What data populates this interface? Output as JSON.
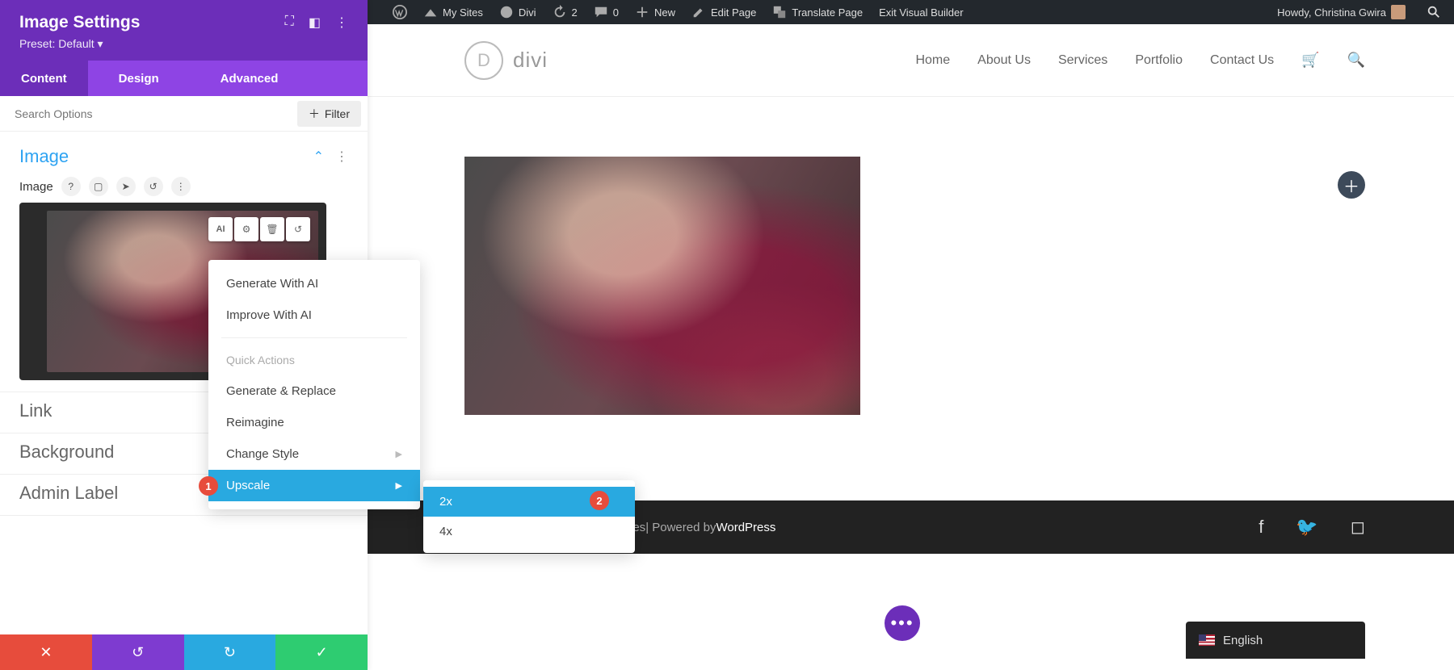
{
  "adminbar": {
    "mysites": "My Sites",
    "divi": "Divi",
    "updates": "2",
    "comments": "0",
    "new": "New",
    "edit": "Edit Page",
    "translate": "Translate Page",
    "exit": "Exit Visual Builder",
    "howdy": "Howdy, Christina Gwira"
  },
  "panel": {
    "title": "Image Settings",
    "preset": "Preset: Default ▾",
    "tabs": {
      "content": "Content",
      "design": "Design",
      "advanced": "Advanced"
    },
    "search_placeholder": "Search Options",
    "filter": "Filter",
    "sections": {
      "image": "Image",
      "image_field": "Image",
      "link": "Link",
      "background": "Background",
      "admin_label": "Admin Label"
    },
    "img_toolbar": {
      "ai": "AI"
    }
  },
  "ai_menu": {
    "generate": "Generate With AI",
    "improve": "Improve With AI",
    "quick": "Quick Actions",
    "replace": "Generate & Replace",
    "reimagine": "Reimagine",
    "change_style": "Change Style",
    "upscale": "Upscale",
    "sub": {
      "x2": "2x",
      "x4": "4x"
    }
  },
  "badges": {
    "one": "1",
    "two": "2"
  },
  "site": {
    "brand": "divi",
    "nav": {
      "home": "Home",
      "about": "About Us",
      "services": "Services",
      "portfolio": "Portfolio",
      "contact": "Contact Us"
    },
    "footer_suffix": "nes",
    "footer_sep": " | Powered by ",
    "footer_wp": "WordPress"
  },
  "lang": {
    "label": "English"
  }
}
